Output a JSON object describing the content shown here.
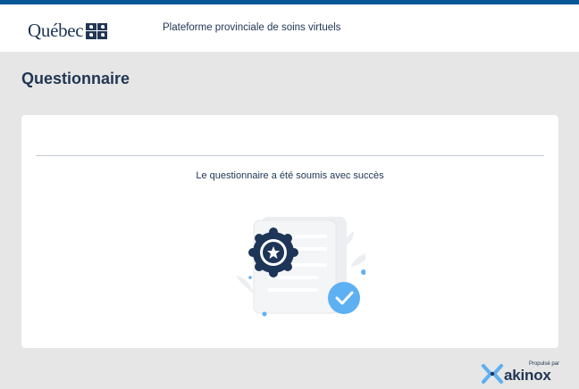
{
  "header": {
    "logo_text": "Québec",
    "platform_title": "Plateforme provinciale de soins virtuels"
  },
  "page": {
    "title": "Questionnaire"
  },
  "card": {
    "success_message": "Le questionnaire a été soumis avec succès"
  },
  "footer": {
    "powered_label": "Propulsé par",
    "brand_name": "akinox"
  },
  "colors": {
    "header_bar": "#095797",
    "primary_text": "#223654",
    "page_background": "#e6e6e6",
    "check_circle": "#5db0f2"
  },
  "icons": [
    "quebec-fleur-de-lis-icon",
    "award-badge-icon",
    "checkmark-icon",
    "akinox-logo-icon"
  ]
}
